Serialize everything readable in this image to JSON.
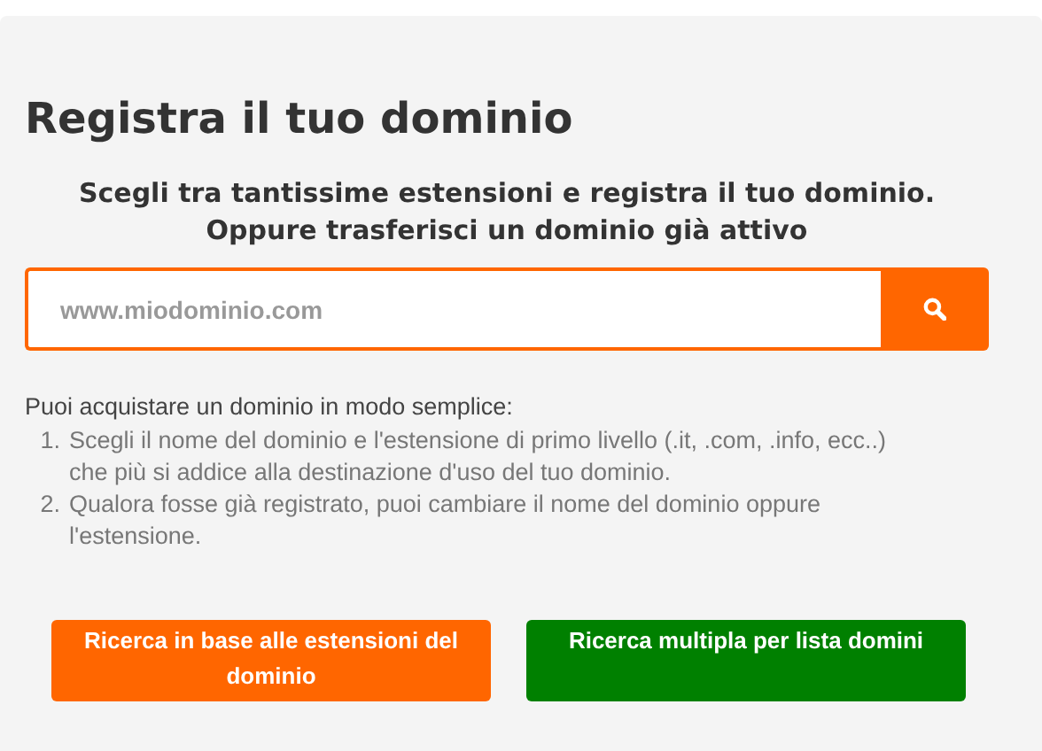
{
  "title": "Registra il tuo dominio",
  "subtitle": [
    "Scegli tra tantissime estensioni e registra il tuo dominio.",
    "Oppure trasferisci un dominio già attivo"
  ],
  "search": {
    "placeholder": "www.miodominio.com"
  },
  "intro": "Puoi acquistare un dominio in modo semplice:",
  "steps": [
    {
      "number": "1.",
      "text": "Scegli il nome del dominio e l'estensione di primo livello (.it, .com, .info, ecc..) che più si addice alla destinazione d'uso del tuo dominio."
    },
    {
      "number": "2.",
      "text": "Qualora fosse già registrato, puoi cambiare il nome del dominio oppure l'estensione."
    }
  ],
  "buttons": [
    {
      "label": "Ricerca in base alle estensioni del dominio",
      "color": "#ff6600"
    },
    {
      "label": "Ricerca multipla per lista domini",
      "color": "#008000"
    }
  ]
}
